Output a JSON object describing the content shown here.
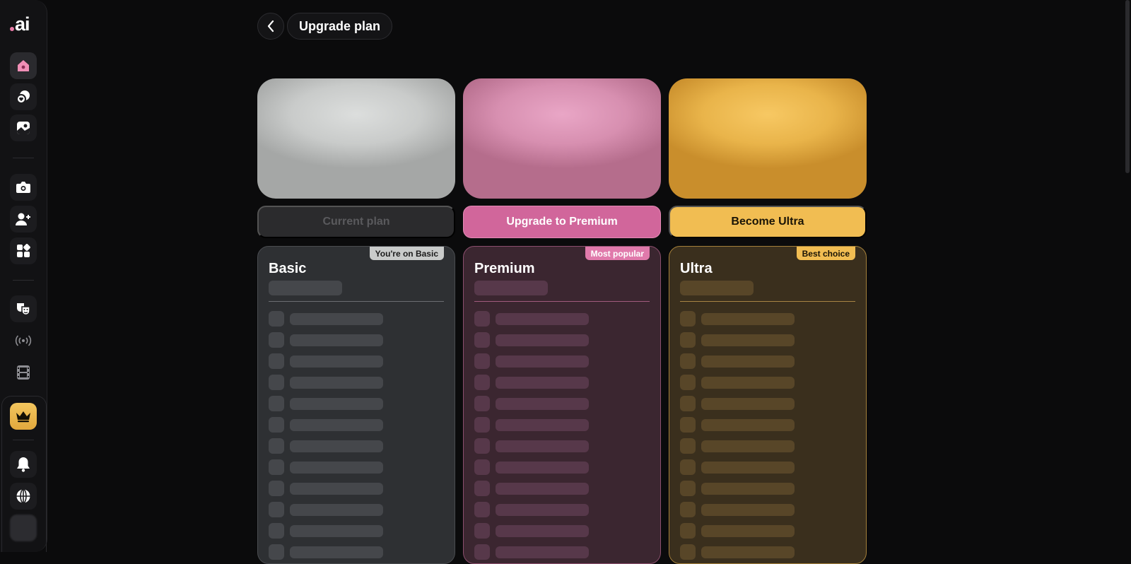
{
  "app": {
    "logo_text": "ai",
    "page_title": "Upgrade plan"
  },
  "colors": {
    "accent_pink": "#d1669b",
    "accent_gold": "#f1bd52",
    "basic_gray": "#c9cbca",
    "background": "#0b0b0c"
  },
  "sidebar": {
    "items": [
      {
        "icon": "home-icon",
        "active": true
      },
      {
        "icon": "chat-heart-icon"
      },
      {
        "icon": "gallery-icon"
      },
      {
        "icon": "camera-icon"
      },
      {
        "icon": "add-user-icon"
      },
      {
        "icon": "widgets-icon"
      },
      {
        "icon": "masks-icon"
      },
      {
        "icon": "broadcast-icon"
      },
      {
        "icon": "film-icon"
      },
      {
        "icon": "crown-icon"
      },
      {
        "icon": "bell-icon"
      },
      {
        "icon": "globe-icon"
      },
      {
        "icon": "avatar"
      }
    ]
  },
  "plans": [
    {
      "id": "basic",
      "name": "Basic",
      "badge": "You're on Basic",
      "cta": "Current plan",
      "cta_enabled": false
    },
    {
      "id": "premium",
      "name": "Premium",
      "badge": "Most popular",
      "cta": "Upgrade to Premium",
      "cta_enabled": true
    },
    {
      "id": "ultra",
      "name": "Ultra",
      "badge": "Best choice",
      "cta": "Become Ultra",
      "cta_enabled": true
    }
  ]
}
